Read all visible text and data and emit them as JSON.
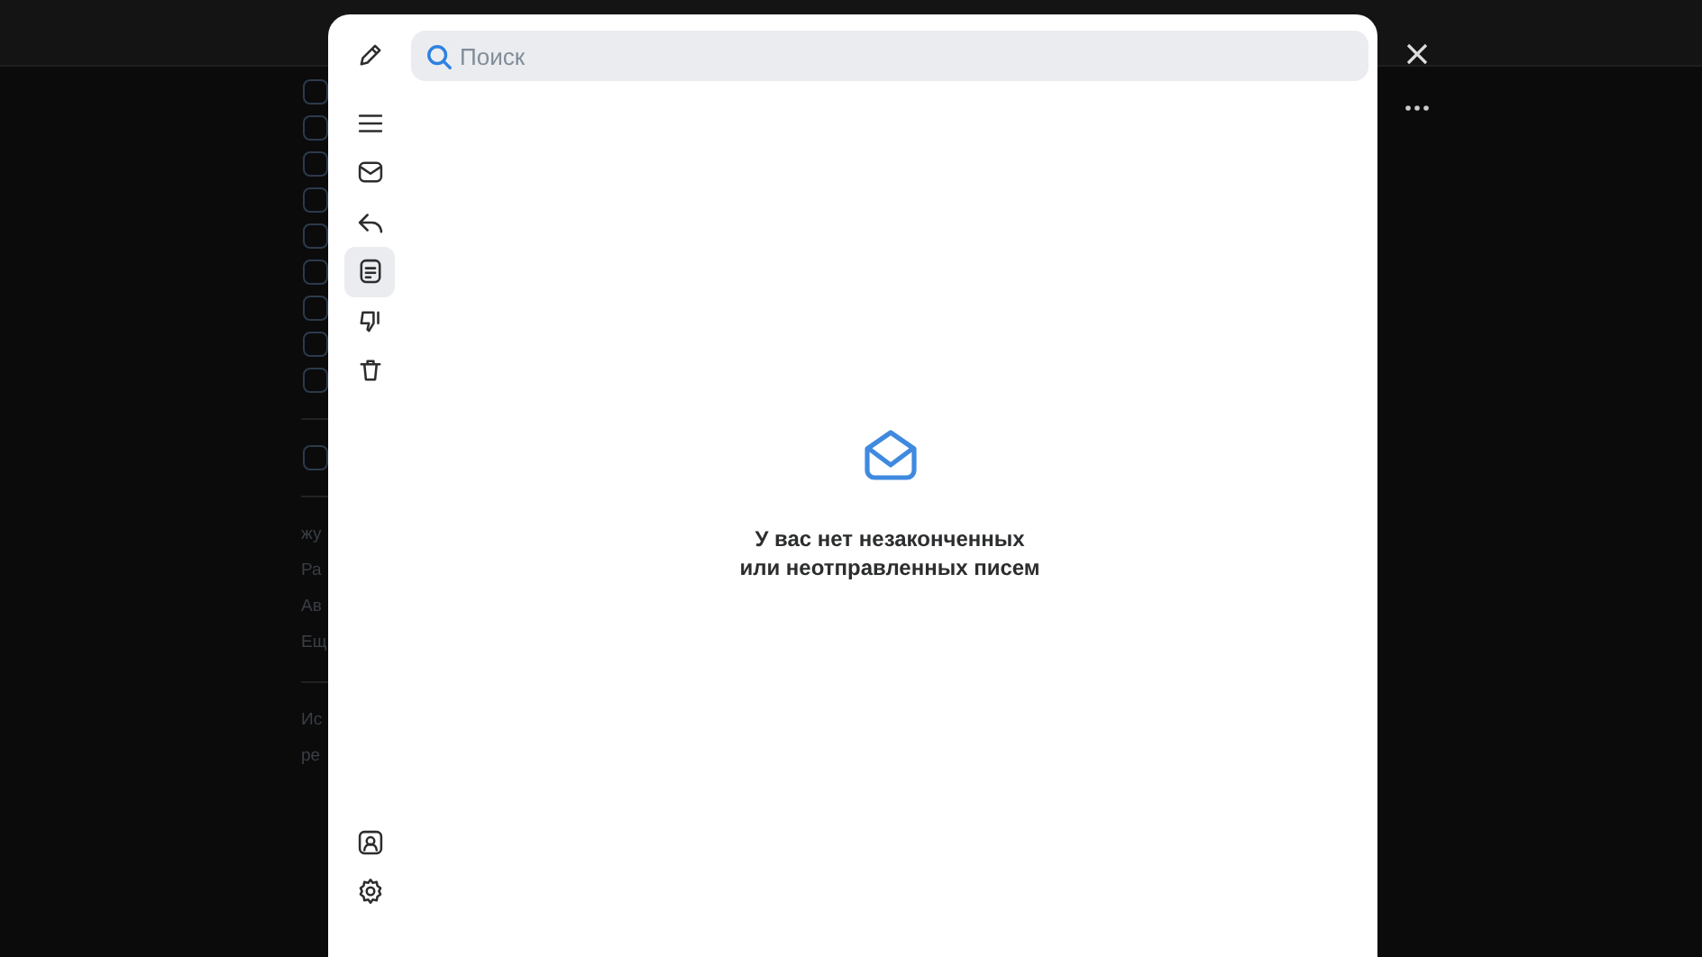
{
  "background_sidebar": {
    "fragments": [
      "жу",
      "Ра",
      "Ав",
      "Ещ"
    ],
    "footer_fragments": [
      "Ис",
      "ре"
    ]
  },
  "rail": {
    "top": [
      {
        "kind": "compose",
        "selected": false
      },
      {
        "kind": "menu",
        "selected": false
      },
      {
        "kind": "inbox",
        "selected": false
      },
      {
        "kind": "sent",
        "selected": false
      },
      {
        "kind": "drafts",
        "selected": true
      },
      {
        "kind": "spam",
        "selected": false
      },
      {
        "kind": "trash",
        "selected": false
      }
    ],
    "bottom": [
      {
        "kind": "contacts",
        "selected": false
      },
      {
        "kind": "settings",
        "selected": false
      }
    ]
  },
  "search": {
    "placeholder": "Поиск"
  },
  "empty_state": {
    "lines": [
      "У вас нет незаконченных",
      "или неотправленных писем"
    ]
  }
}
